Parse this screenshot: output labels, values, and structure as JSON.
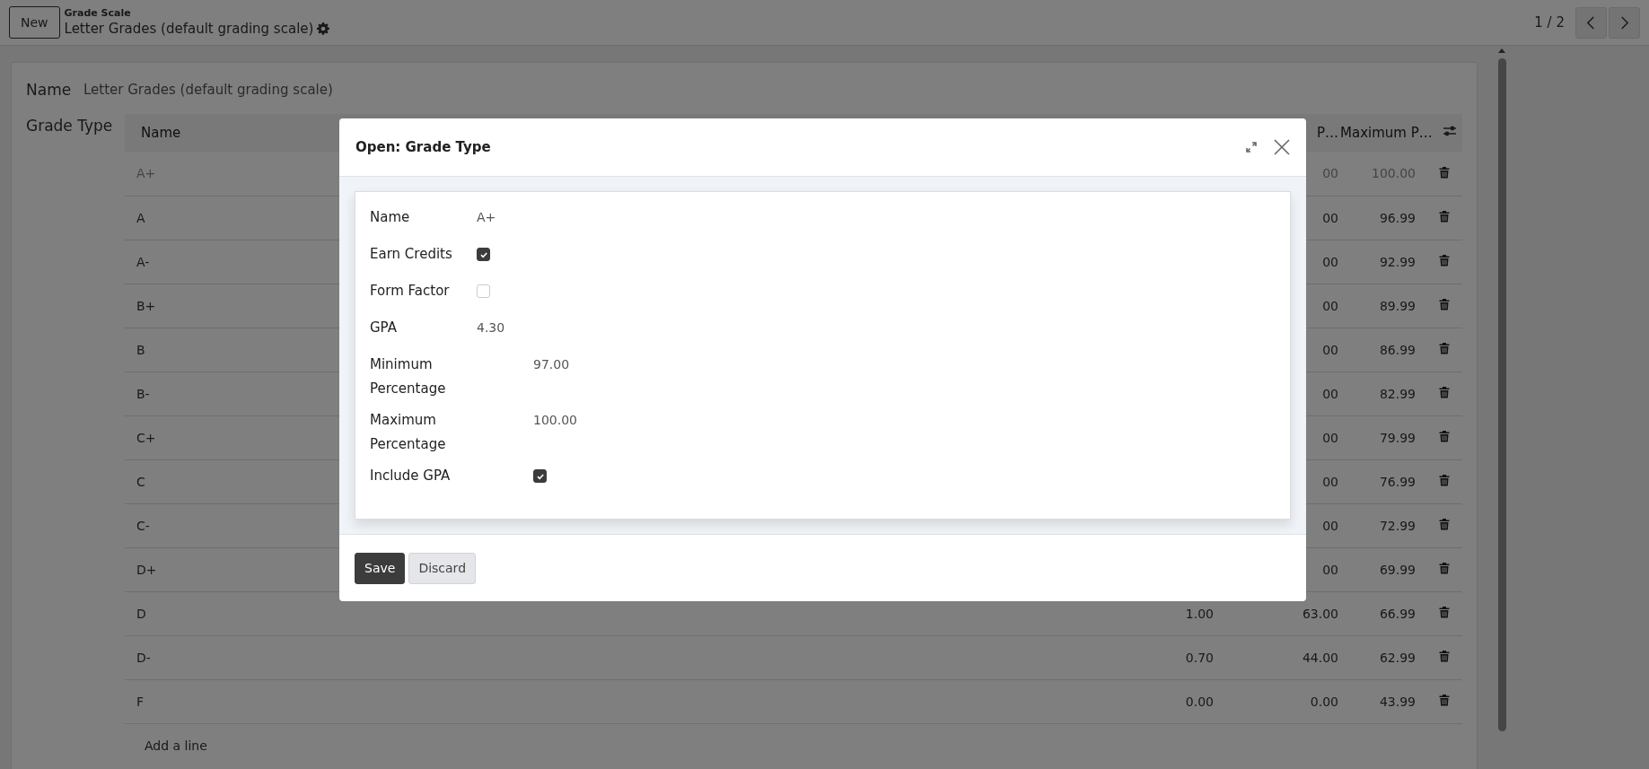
{
  "topbar": {
    "new_button": "New",
    "breadcrumb_parent": "Grade Scale",
    "record_title": "Letter Grades (default grading scale)",
    "pager": "1 / 2"
  },
  "sheet": {
    "name_label": "Name",
    "name_value": "Letter Grades (default grading scale)",
    "grade_type_label": "Grade Type"
  },
  "table": {
    "columns": {
      "name": "Name",
      "column_3": "P…",
      "column_4": "Maximum P…"
    },
    "rows": [
      {
        "name": "A+",
        "column_3": "00",
        "column_4": "100.00",
        "editing": true
      },
      {
        "name": "A",
        "column_3": "00",
        "column_4": "96.99",
        "editing": false
      },
      {
        "name": "A-",
        "column_3": "00",
        "column_4": "92.99",
        "editing": false
      },
      {
        "name": "B+",
        "column_3": "00",
        "column_4": "89.99",
        "editing": false
      },
      {
        "name": "B",
        "column_3": "00",
        "column_4": "86.99",
        "editing": false
      },
      {
        "name": "B-",
        "column_3": "00",
        "column_4": "82.99",
        "editing": false
      },
      {
        "name": "C+",
        "column_3": "00",
        "column_4": "79.99",
        "editing": false
      },
      {
        "name": "C",
        "column_3": "00",
        "column_4": "76.99",
        "editing": false
      },
      {
        "name": "C-",
        "column_3": "00",
        "column_4": "72.99",
        "editing": false
      },
      {
        "name": "D+",
        "column_3": "00",
        "column_4": "69.99",
        "editing": false
      },
      {
        "name": "D",
        "column_2": "1.00",
        "column_3": "63.00",
        "column_4": "66.99",
        "editing": false
      },
      {
        "name": "D-",
        "column_2": "0.70",
        "column_3": "44.00",
        "column_4": "62.99",
        "editing": false
      },
      {
        "name": "F",
        "column_2": "0.00",
        "column_3": "0.00",
        "column_4": "43.99",
        "editing": false
      }
    ],
    "add_line": "Add a line"
  },
  "dialog": {
    "title": "Open: Grade Type",
    "groups": [
      {
        "fields": [
          {
            "kind": "text",
            "label": "Name",
            "value": "A+"
          },
          {
            "kind": "checkbox",
            "label": "Earn Credits",
            "checked": true
          },
          {
            "kind": "checkbox",
            "label": "Form Factor",
            "checked": false
          },
          {
            "kind": "text",
            "label": "GPA",
            "value": "4.30"
          }
        ]
      },
      {
        "fields": [
          {
            "kind": "text",
            "label": "Minimum Percentage",
            "value": "97.00"
          },
          {
            "kind": "text",
            "label": "Maximum Percentage",
            "value": "100.00"
          },
          {
            "kind": "checkbox",
            "label": "Include GPA",
            "checked": true
          }
        ]
      }
    ],
    "buttons": [
      {
        "kind": "primary",
        "label": "Save"
      },
      {
        "kind": "secondary",
        "label": "Discard"
      }
    ]
  }
}
